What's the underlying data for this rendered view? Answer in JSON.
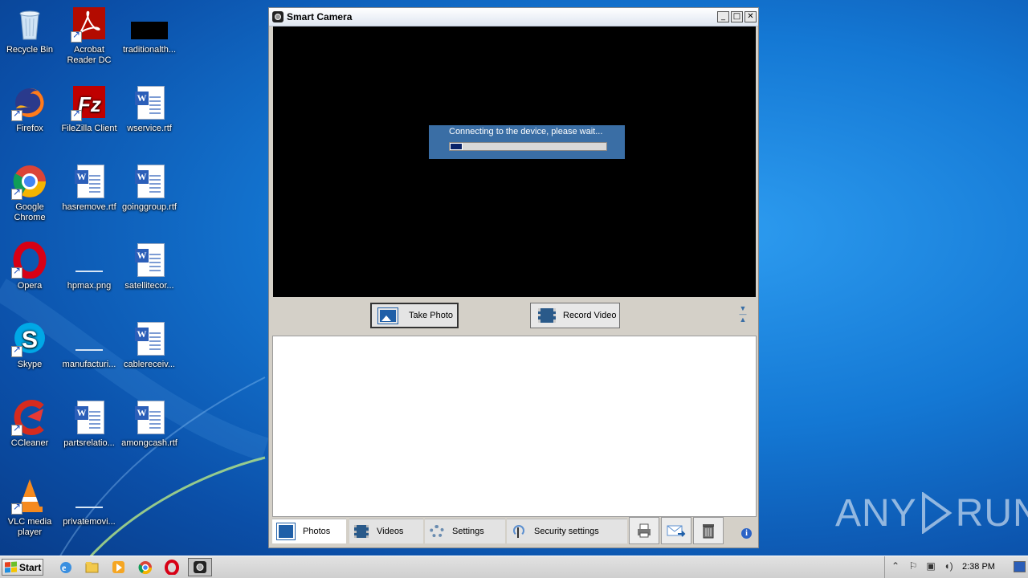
{
  "desktop": {
    "icons": [
      {
        "label": "Recycle Bin",
        "icon": "recycle-bin-icon"
      },
      {
        "label": "Acrobat Reader DC",
        "icon": "acrobat-icon"
      },
      {
        "label": "traditionalth...",
        "icon": "black-file-icon"
      },
      {
        "label": "Firefox",
        "icon": "firefox-icon"
      },
      {
        "label": "FileZilla Client",
        "icon": "filezilla-icon"
      },
      {
        "label": "wservice.rtf",
        "icon": "word-doc-icon"
      },
      {
        "label": "Google Chrome",
        "icon": "chrome-icon"
      },
      {
        "label": "hasremove.rtf",
        "icon": "word-doc-icon"
      },
      {
        "label": "goinggroup.rtf",
        "icon": "word-doc-icon"
      },
      {
        "label": "Opera",
        "icon": "opera-icon"
      },
      {
        "label": "hpmax.png",
        "icon": "image-file-icon"
      },
      {
        "label": "satellitecor...",
        "icon": "word-doc-icon"
      },
      {
        "label": "Skype",
        "icon": "skype-icon"
      },
      {
        "label": "manufacturi...",
        "icon": "blank-file-icon"
      },
      {
        "label": "cablereceiv...",
        "icon": "word-doc-icon"
      },
      {
        "label": "CCleaner",
        "icon": "ccleaner-icon"
      },
      {
        "label": "partsrelatio...",
        "icon": "word-doc-icon"
      },
      {
        "label": "amongcash.rtf",
        "icon": "word-doc-icon"
      },
      {
        "label": "VLC media player",
        "icon": "vlc-icon"
      },
      {
        "label": "privatemovi...",
        "icon": "blank-file-icon"
      }
    ]
  },
  "window": {
    "title": "Smart Camera",
    "controls": {
      "minimize": "_",
      "maximize": "□",
      "close": "✕"
    },
    "connecting_text": "Connecting to the device, please wait...",
    "progress": 0.08,
    "take_photo": "Take Photo",
    "record_video": "Record Video",
    "tabs": [
      {
        "label": "Photos",
        "icon": "photo-icon"
      },
      {
        "label": "Videos",
        "icon": "film-icon"
      },
      {
        "label": "Settings",
        "icon": "gear-icon"
      },
      {
        "label": "Security settings",
        "icon": "antenna-icon"
      }
    ],
    "actions": [
      "print-icon",
      "email-icon",
      "trash-icon"
    ],
    "info": "i"
  },
  "taskbar": {
    "start_label": "Start",
    "clock": "2:38 PM",
    "pinned": [
      "internet-explorer-icon",
      "explorer-icon",
      "media-player-icon",
      "chrome-icon",
      "opera-icon",
      "smart-camera-icon"
    ]
  },
  "watermark": {
    "left": "ANY",
    "right": "RUN"
  },
  "colors": {
    "accent": "#3a6ea5",
    "progress_fill": "#0a246a",
    "desktop": "#1478d4"
  }
}
